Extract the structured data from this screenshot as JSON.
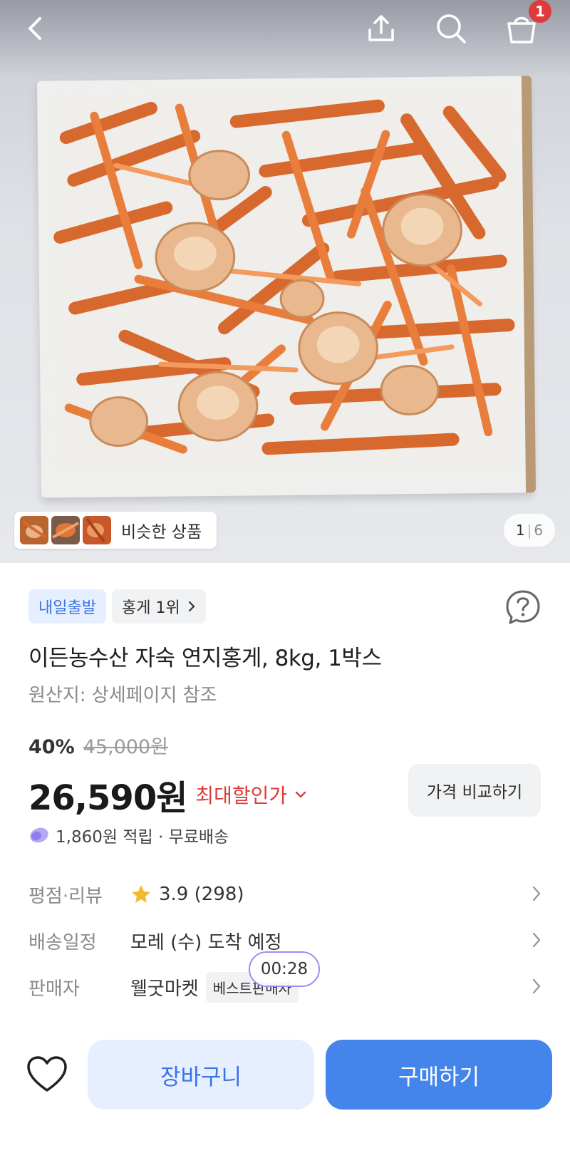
{
  "header": {
    "back_icon": "chevron-left-icon",
    "share_icon": "share-icon",
    "search_icon": "search-icon",
    "cart_icon": "shopping-bag-icon",
    "cart_count": "1"
  },
  "gallery": {
    "similar_label": "비슷한 상품",
    "page_current": "1",
    "page_separator": "|",
    "page_total": "6"
  },
  "product": {
    "delivery_badge": "내일출발",
    "rank_badge": "홍게 1위",
    "title": "이든농수산 자숙 연지홍게, 8kg, 1박스",
    "origin": "원산지: 상세페이지 참조",
    "discount_percent": "40%",
    "original_price": "45,000원",
    "price": "26,590원",
    "max_discount_label": "최대할인가",
    "compare_label": "가격 비교하기",
    "reward_text": "1,860원 적립 · 무료배송"
  },
  "details": {
    "rating_label": "평점·리뷰",
    "rating_value": "3.9 (298)",
    "delivery_label": "배송일정",
    "delivery_value": "모레 (수) 도착 예정",
    "seller_label": "판매자",
    "seller_value": "웰굿마켓",
    "seller_badge": "베스트판매자"
  },
  "overlay": {
    "timer": "00:28"
  },
  "bottom_bar": {
    "wishlist_icon": "heart-icon",
    "cart_label": "장바구니",
    "buy_label": "구매하기"
  },
  "colors": {
    "accent_blue": "#4485ec",
    "accent_blue_light": "#e6efff",
    "discount_red": "#e03a3a",
    "badge_red": "#e03a3a",
    "star_yellow": "#f5b82e"
  }
}
